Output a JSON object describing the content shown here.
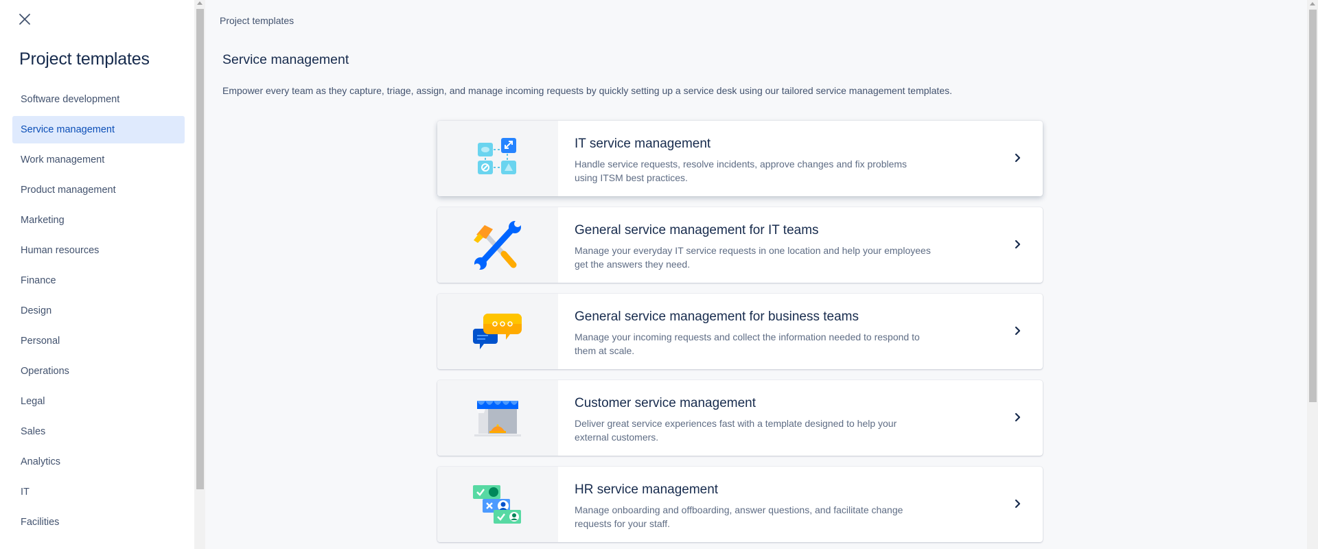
{
  "sidebar": {
    "close_icon": "close-icon",
    "title": "Project templates",
    "items": [
      {
        "label": "Software development",
        "active": false
      },
      {
        "label": "Service management",
        "active": true
      },
      {
        "label": "Work management",
        "active": false
      },
      {
        "label": "Product management",
        "active": false
      },
      {
        "label": "Marketing",
        "active": false
      },
      {
        "label": "Human resources",
        "active": false
      },
      {
        "label": "Finance",
        "active": false
      },
      {
        "label": "Design",
        "active": false
      },
      {
        "label": "Personal",
        "active": false
      },
      {
        "label": "Operations",
        "active": false
      },
      {
        "label": "Legal",
        "active": false
      },
      {
        "label": "Sales",
        "active": false
      },
      {
        "label": "Analytics",
        "active": false
      },
      {
        "label": "IT",
        "active": false
      },
      {
        "label": "Facilities",
        "active": false
      }
    ]
  },
  "main": {
    "breadcrumb": "Project templates",
    "title": "Service management",
    "description": "Empower every team as they capture, triage, assign, and manage incoming requests by quickly setting up a service desk using our tailored service management templates.",
    "cards": [
      {
        "title": "IT service management",
        "description": "Handle service requests, resolve incidents, approve changes and fix problems using ITSM best practices.",
        "icon": "itsm-flow-icon"
      },
      {
        "title": "General service management for IT teams",
        "description": "Manage your everyday IT service requests in one location and help your employees get the answers they need.",
        "icon": "wrench-hammer-icon"
      },
      {
        "title": "General service management for business teams",
        "description": "Manage your incoming requests and collect the information needed to respond to them at scale.",
        "icon": "chat-bubbles-icon"
      },
      {
        "title": "Customer service management",
        "description": "Deliver great service experiences fast with a template designed to help your external customers.",
        "icon": "storefront-bell-icon"
      },
      {
        "title": "HR service management",
        "description": "Manage onboarding and offboarding, answer questions, and facilitate change requests for your staff.",
        "icon": "people-cards-icon"
      }
    ]
  },
  "colors": {
    "active_bg": "#dfeafd",
    "active_text": "#0c4fb7",
    "text_primary": "#172b4d",
    "text_secondary": "#42526e",
    "main_bg": "#f7f8fa"
  }
}
